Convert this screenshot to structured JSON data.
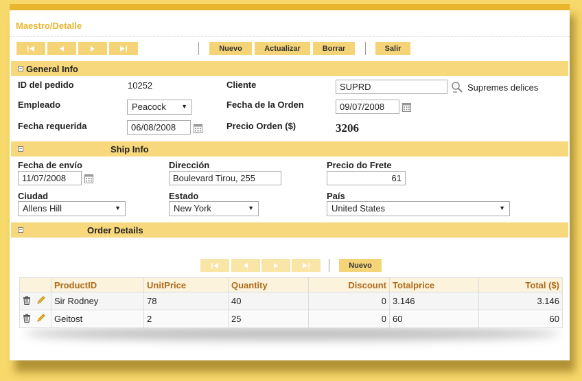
{
  "header": {
    "title": "Maestro/Detalle"
  },
  "toolbar": {
    "nuevo": "Nuevo",
    "actualizar": "Actualizar",
    "borrar": "Borrar",
    "salir": "Salir"
  },
  "general": {
    "section_title": "General Info",
    "id_label": "ID del pedido",
    "id_value": "10252",
    "cliente_label": "Cliente",
    "cliente_value": "SUPRD",
    "cliente_name": "Supremes delices",
    "empleado_label": "Empleado",
    "empleado_value": "Peacock",
    "fecha_orden_label": "Fecha de la Orden",
    "fecha_orden_value": "09/07/2008",
    "fecha_req_label": "Fecha requerida",
    "fecha_req_value": "06/08/2008",
    "precio_label": "Precio Orden ($)",
    "precio_value": "3206"
  },
  "ship": {
    "section_title": "Ship Info",
    "fecha_envio_label": "Fecha de envío",
    "fecha_envio_value": "11/07/2008",
    "direccion_label": "Dirección",
    "direccion_value": "Boulevard Tirou, 255",
    "frete_label": "Precio do Frete",
    "frete_value": "61",
    "ciudad_label": "Ciudad",
    "ciudad_value": "Allens Hill",
    "estado_label": "Estado",
    "estado_value": "New York",
    "pais_label": "País",
    "pais_value": "United States"
  },
  "details": {
    "section_title": "Order Details",
    "nuevo": "Nuevo",
    "columns": [
      "ProductID",
      "UnitPrice",
      "Quantity",
      "Discount",
      "Totalprice",
      "Total ($)"
    ],
    "rows": [
      {
        "product": "Sir Rodney",
        "unit_price": "78",
        "quantity": "40",
        "discount": "0",
        "totalprice": "3.146",
        "total": "3.146"
      },
      {
        "product": "Geitost",
        "unit_price": "2",
        "quantity": "25",
        "discount": "0",
        "totalprice": "60",
        "total": "60"
      }
    ]
  },
  "colors": {
    "accent": "#e8b52c",
    "section": "#f7d87d",
    "button": "#f5d478",
    "header_text": "#b06a1a"
  }
}
